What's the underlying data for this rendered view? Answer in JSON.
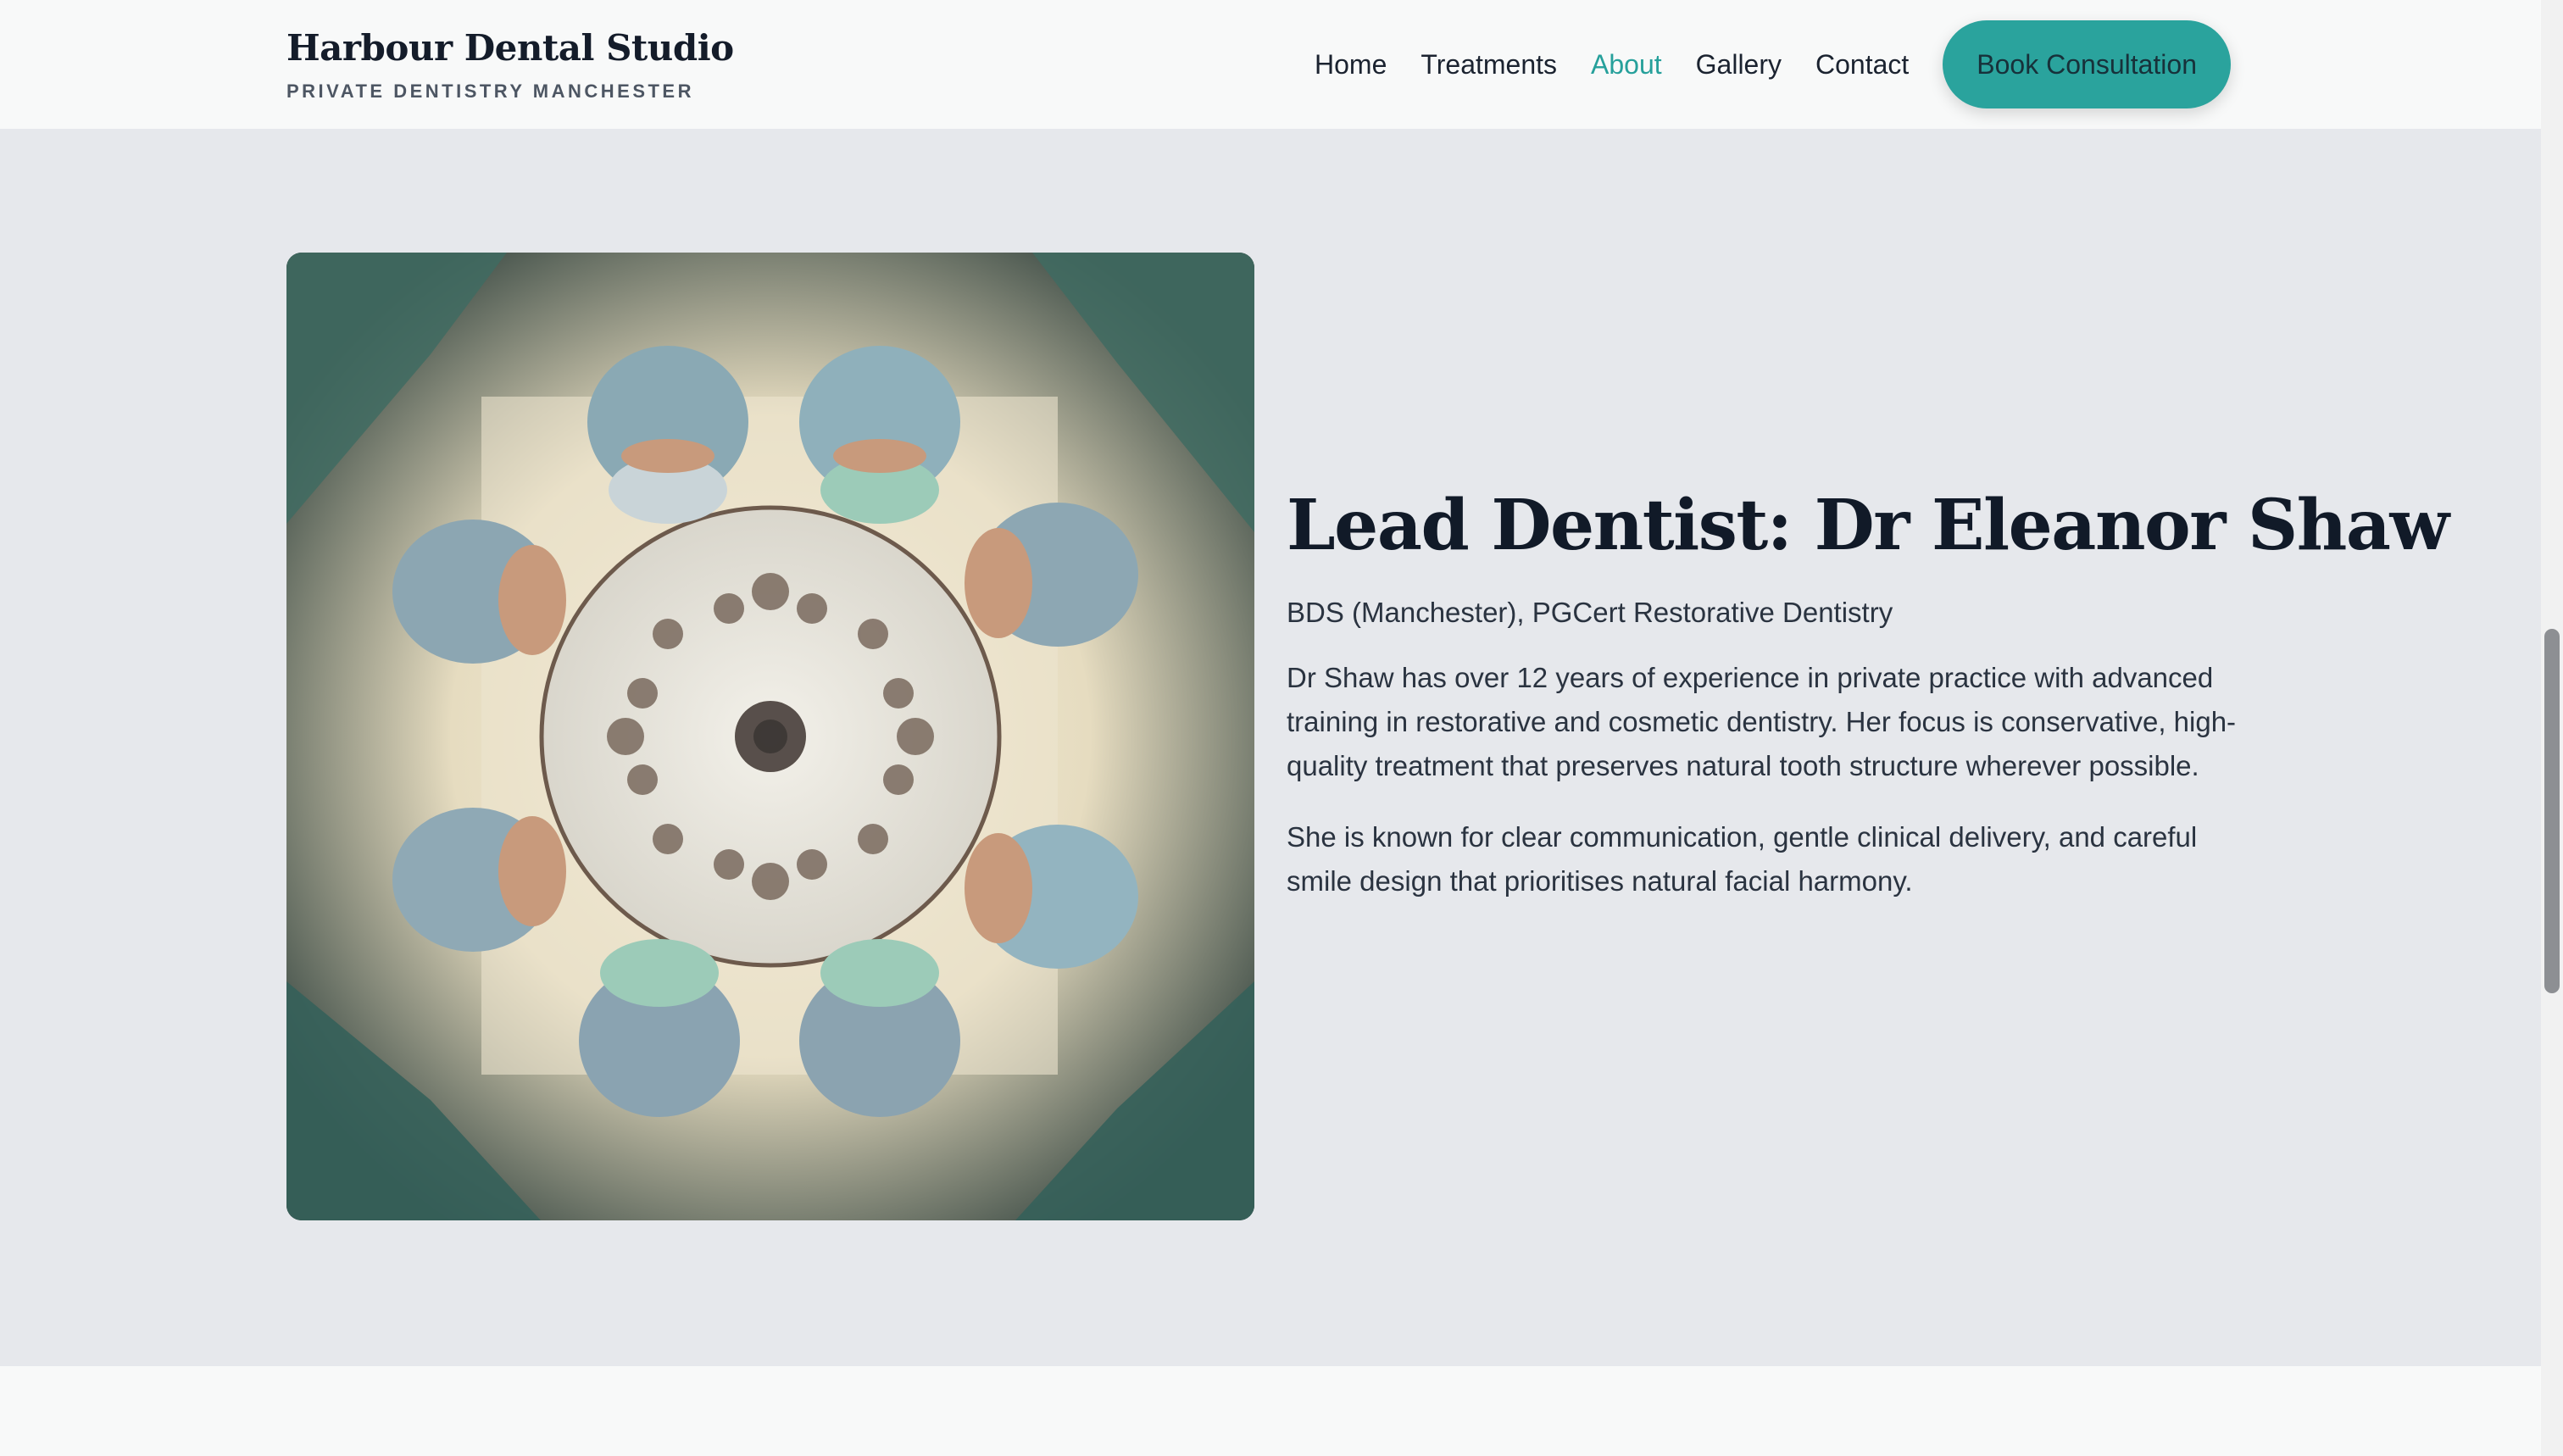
{
  "brand": {
    "name": "Harbour Dental Studio",
    "tagline": "PRIVATE DENTISTRY MANCHESTER"
  },
  "nav": {
    "items": [
      {
        "label": "Home",
        "active": false
      },
      {
        "label": "Treatments",
        "active": false
      },
      {
        "label": "About",
        "active": true
      },
      {
        "label": "Gallery",
        "active": false
      },
      {
        "label": "Contact",
        "active": false
      }
    ],
    "cta": "Book Consultation"
  },
  "bio": {
    "title": "Lead Dentist: Dr Eleanor Shaw",
    "credentials": "BDS (Manchester), PGCert Restorative Dentistry",
    "paragraphs": [
      "Dr Shaw has over 12 years of experience in private practice with advanced training in restorative and cosmetic dentistry. Her focus is conservative, high-quality treatment that preserves natural tooth structure wherever possible.",
      "She is known for clear communication, gentle clinical delivery, and careful smile design that prioritises natural facial harmony."
    ]
  },
  "colors": {
    "accent": "#2aa39d",
    "active_link": "#26a09b",
    "header_bg": "#f8f9f9",
    "section_bg": "#e6e8ec"
  }
}
